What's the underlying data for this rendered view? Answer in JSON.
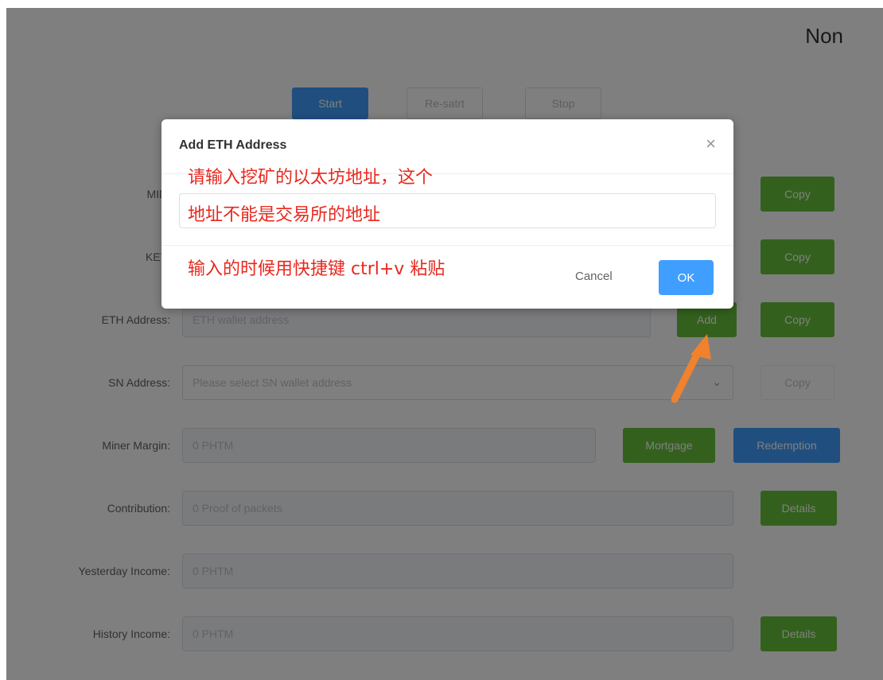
{
  "header": {
    "status": "Non"
  },
  "controls": {
    "start": "Start",
    "restart": "Re-satrt",
    "stop": "Stop"
  },
  "form": {
    "mid": {
      "label": "MID:",
      "copy": "Copy"
    },
    "key": {
      "label": "KEY:",
      "copy": "Copy"
    },
    "eth": {
      "label": "ETH Address:",
      "placeholder": "ETH wallet address",
      "add": "Add",
      "copy": "Copy"
    },
    "sn": {
      "label": "SN Address:",
      "placeholder": "Please select SN wallet address",
      "copy": "Copy"
    },
    "margin": {
      "label": "Miner Margin:",
      "value": "0 PHTM",
      "mortgage": "Mortgage",
      "redemption": "Redemption"
    },
    "contribution": {
      "label": "Contribution:",
      "value": "0 Proof of packets",
      "details": "Details"
    },
    "yesterday": {
      "label": "Yesterday Income:",
      "value": "0 PHTM"
    },
    "history": {
      "label": "History Income:",
      "value": "0 PHTM",
      "details": "Details"
    }
  },
  "dialog": {
    "title": "Add ETH Address",
    "close": "×",
    "cancel": "Cancel",
    "ok": "OK"
  },
  "annotations": {
    "line1": "请输入挖矿的以太坊地址，这个",
    "line2": "地址不能是交易所的地址",
    "line3": "输入的时候用快捷键 ctrl+v 粘贴"
  },
  "colors": {
    "primary": "#409eff",
    "success": "#67c23a",
    "annotation": "#e8281e",
    "arrow": "#f0822d"
  }
}
